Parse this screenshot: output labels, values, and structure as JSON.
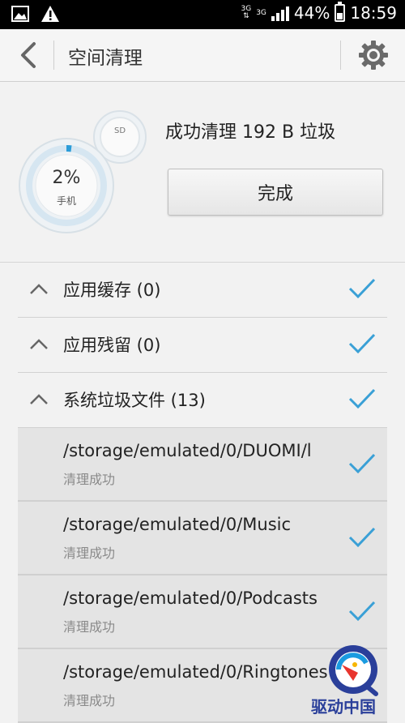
{
  "status_bar": {
    "network_left": "3G",
    "network_right": "3G",
    "battery": "44%",
    "time": "18:59"
  },
  "app_bar": {
    "title": "空间清理"
  },
  "summary": {
    "phone_percent": "2%",
    "phone_label": "手机",
    "sd_label": "SD",
    "result_text": "成功清理 192 B 垃圾",
    "done_label": "完成"
  },
  "categories": [
    {
      "label": "应用缓存 (0)"
    },
    {
      "label": "应用残留 (0)"
    },
    {
      "label": "系统垃圾文件 (13)"
    }
  ],
  "files": [
    {
      "path": "/storage/emulated/0/DUOMI/l",
      "status": "清理成功"
    },
    {
      "path": "/storage/emulated/0/Music",
      "status": "清理成功"
    },
    {
      "path": "/storage/emulated/0/Podcasts",
      "status": "清理成功"
    },
    {
      "path": "/storage/emulated/0/Ringtones",
      "status": "清理成功"
    }
  ],
  "watermark": {
    "text": "驱动中国"
  },
  "colors": {
    "accent": "#2b9cd8",
    "check": "#3aa0d6"
  }
}
